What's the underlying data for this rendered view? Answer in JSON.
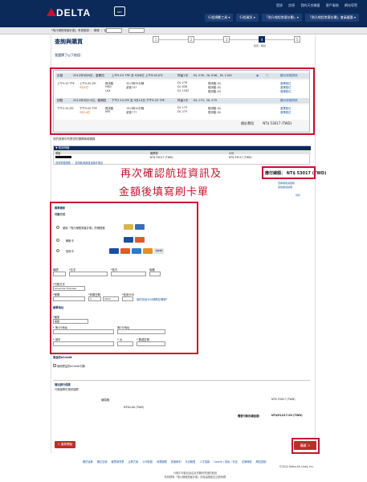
{
  "header": {
    "logo_text": "DELTA",
    "sky_label": "SKY",
    "top_links": [
      "登錄",
      "註冊",
      "我的天合聯盟",
      "客戶服務",
      "網站導覽"
    ],
    "nav": [
      "行程規劃工具 ▾",
      "行程資訊 ▾",
      "「飛凡哩程常客計劃」▾",
      "「飛凡哩程常客計劃」會員優惠 ▾"
    ],
    "search_placeholder": ""
  },
  "subbar": {
    "text": "「飛凡哩程常客計劃」會員登錄 ｜ 帳號 ｜ 密碼"
  },
  "page": {
    "title": "查詢與購買",
    "notice": "我選擇了以下航班：",
    "steps": [
      "1",
      "2",
      "3",
      "4",
      "5"
    ],
    "step_labels": [
      "",
      "",
      "",
      "檢查 / 購買",
      ""
    ]
  },
  "flights": {
    "outbound_header": {
      "label": "出發",
      "date": "2012年9月6日，星期四",
      "time": "上午9:10 TPE 至 9月6日 上午9:45 JFK",
      "stops": "停留1次",
      "flights": "DL 276，DL 636，DL 1162"
    },
    "outbound_segments": [
      {
        "dep": "上午9:10 TPE",
        "arr": "上午5:45 JFK",
        "class": "經濟艙",
        "seat": "32小時35分鐘",
        "aircraft": "波音747",
        "flight": "DL 276",
        "cabin": "經濟艙 (K)",
        "link": "選擇座位"
      },
      {
        "dep": "",
        "arr": "HND",
        "class": "",
        "seat": "",
        "aircraft": "",
        "flight": "DL 636",
        "cabin": "經濟艙 (K)",
        "link": "選擇座位"
      },
      {
        "dep": "",
        "arr": "LAX",
        "class": "",
        "seat": "",
        "aircraft": "",
        "flight": "DL 1162",
        "cabin": "經濟艙 (K)",
        "link": "選擇座位"
      }
    ],
    "return_header": {
      "label": "回程",
      "date": "2012年9月13日，星期四",
      "time": "下午2:10 JFK 至 9月14日 下午9:20 TPE",
      "stops": "停留1次",
      "flights": "DL 173，DL 275"
    },
    "return_segments": [
      {
        "dep": "下午2:10 JFK",
        "arr": "下午9:20 TPE",
        "class": "經濟艙",
        "seat": "19小時10分鐘",
        "aircraft": "波音777",
        "flight": "DL 173",
        "cabin": "經濟艙 (K)",
        "link": "選擇座位"
      },
      {
        "dep": "",
        "arr": "NRT",
        "class": "",
        "seat": "",
        "aircraft": "",
        "flight": "DL 275",
        "cabin": "經濟艙 (K)",
        "link": "選擇座位"
      }
    ],
    "total_label": "總計費用",
    "total_value": "NT$ 53017 (TWD)"
  },
  "fare": {
    "section_label": "您的旅程中所提供的選擇與總價格",
    "bar_label": "▼ 費用明細",
    "col1": "乘客",
    "col2": "機票價",
    "col3": "小計",
    "row_price": "NT$ 53017 (TWD)",
    "row_subtotal": "NT$ 53017 (TWD)",
    "link": "查詢票價規則 ｜ 查詢取消與退還條件規定"
  },
  "annotation": {
    "line1": "再次確認航班資訊及",
    "line2": "金額後填寫刷卡單"
  },
  "summary": {
    "total_label": "應付總額：",
    "total_value": "NT$ 53017 (TWD)",
    "links": [
      "查看規則與限制",
      "其他費用說明",
      "列印"
    ]
  },
  "payment": {
    "title": "帳單資訊",
    "subtitle": "付款方式",
    "option1": "使用「飛凡哩程常客計劃」的哩程數",
    "option2": "轉帳卡",
    "option3": "信用卡",
    "name_labels": [
      "稱謂",
      "*名字",
      "*姓氏",
      "後綴"
    ],
    "card_type_label": "*付款方式",
    "card_type_value": "American Express",
    "card_number_label": "*號碼",
    "expiry_label": "*到期日期",
    "cvv_label": "*信用卡ID",
    "cvv_link": "我的信用卡ID號碼在哪裡？",
    "month_value": "1",
    "year_value": "2012",
    "address_title": "帳單地址",
    "country_label": "*國家",
    "country_value": "美國",
    "address1_label": "* 第1行地址",
    "address2_label": "第2行地址",
    "city_label": "* 城市",
    "state_label": "* 州",
    "zip_label": "* 郵遞區號"
  },
  "ecredit": {
    "title": "恩益的eCredit",
    "checkbox_label": "使用恩益的eCredit付款"
  },
  "insurance": {
    "title": "增加旅行保險",
    "subtitle": "行程保障可提供保障",
    "fare_label": "總價格：",
    "fare_value": "NT$ 53017 (TWD)",
    "ins_value": "NT$0.00 (TWD)",
    "grand_label": "需要付款的總金額：",
    "grand_value": "NT$53,017.00 (TWD)"
  },
  "buttons": {
    "start_over": "< 重新開始",
    "buy": "購買 >"
  },
  "footer": {
    "links": [
      "關於達美",
      "職位空缺",
      "機票與營業",
      "企業方案",
      "公司新聞",
      "商業服務",
      "旅客權利",
      "天合聯盟",
      "人才招募",
      "Cookie / 隱私 / 安全",
      "法律條款",
      "網站回饋"
    ],
    "copyright": "©2012 Delta Air Lines, Inc.",
    "note1": "行程中可能包含由合作夥伴營運的航班",
    "note2": "所有標有「飛凡哩程常客計劃」的為達美航空註冊商標"
  }
}
